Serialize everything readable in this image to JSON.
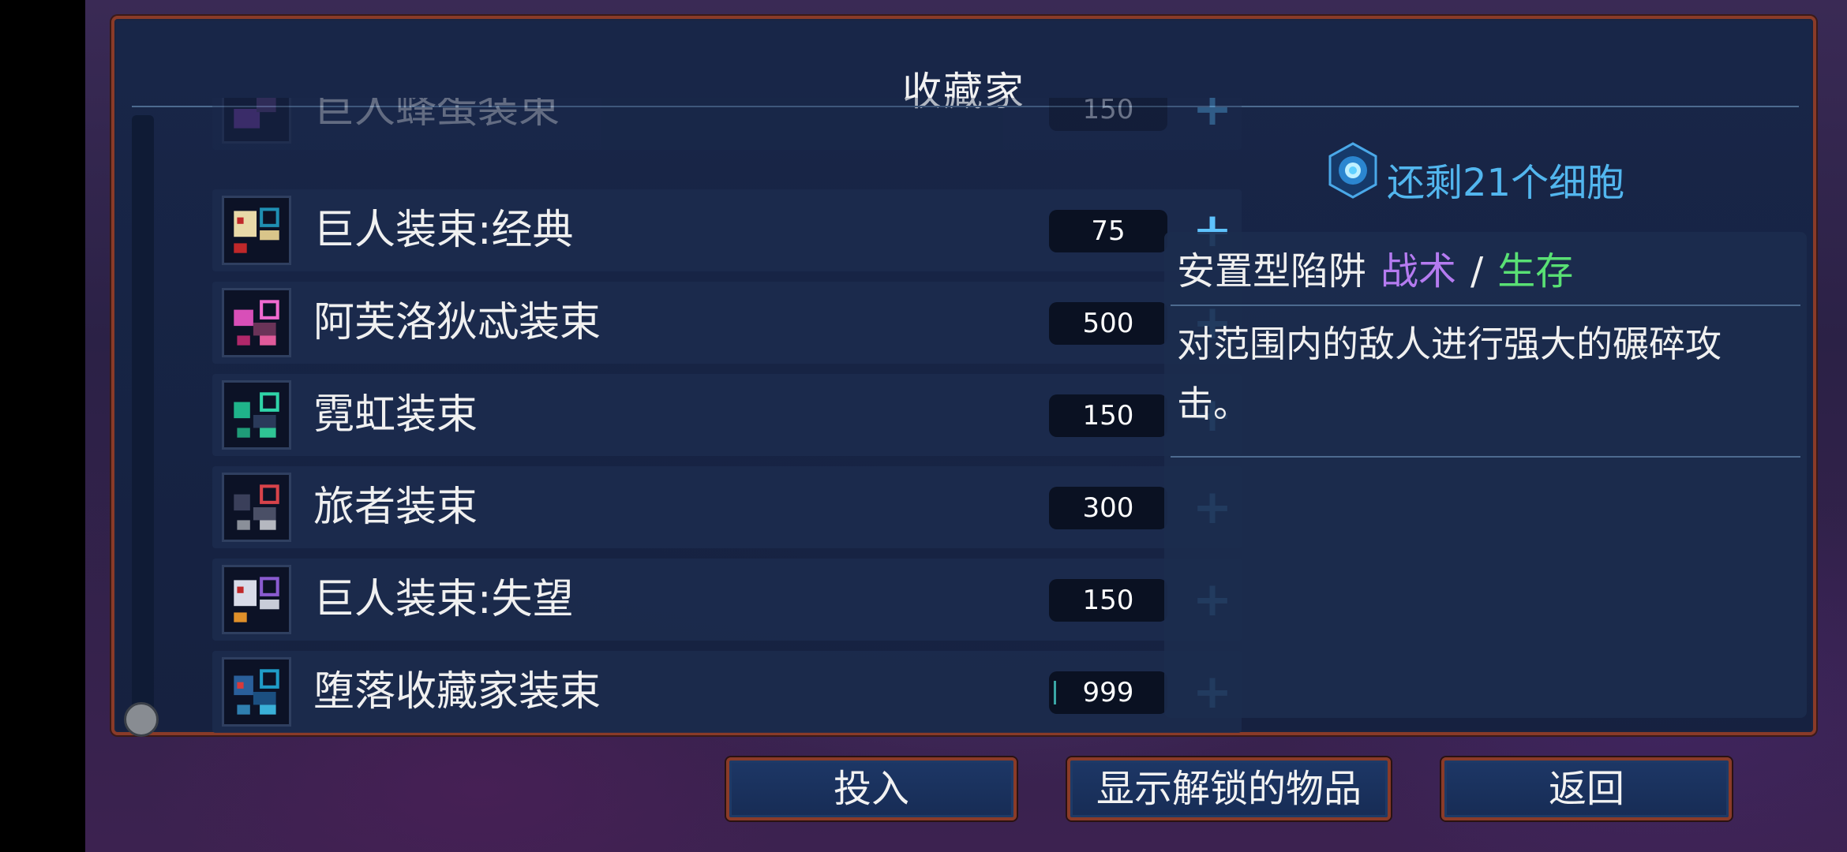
{
  "window": {
    "title": "收藏家"
  },
  "items": [
    {
      "name": "巨人蜂蛋装束",
      "cost": "150",
      "icon": "giant-bee-outfit-icon"
    },
    {
      "name": "巨人装束:经典",
      "cost": "75",
      "icon": "giant-outfit-classic-icon"
    },
    {
      "name": "阿芙洛狄忒装束",
      "cost": "500",
      "icon": "aphrodite-outfit-icon"
    },
    {
      "name": "霓虹装束",
      "cost": "150",
      "icon": "neon-outfit-icon"
    },
    {
      "name": "旅者装束",
      "cost": "300",
      "icon": "traveler-outfit-icon"
    },
    {
      "name": "巨人装束:失望",
      "cost": "150",
      "icon": "giant-outfit-disappointment-icon"
    },
    {
      "name": "堕落收藏家装束",
      "cost": "999",
      "icon": "fallen-collector-outfit-icon"
    }
  ],
  "add_label": "+",
  "cells": {
    "text": "还剩21个细胞",
    "icon": "cell-icon"
  },
  "detail": {
    "type": "安置型陷阱",
    "tag_tactic": "战术",
    "separator": "/",
    "tag_survival": "生存",
    "description": "对范围内的敌人进行强大的碾碎攻击。"
  },
  "buttons": {
    "invest": "投入",
    "show_unlocked": "显示解锁的物品",
    "back": "返回"
  },
  "colors": {
    "accent": "#52b6ee",
    "tactic": "#b57bf0",
    "survival": "#59e074",
    "frame": "#8a3b28"
  }
}
